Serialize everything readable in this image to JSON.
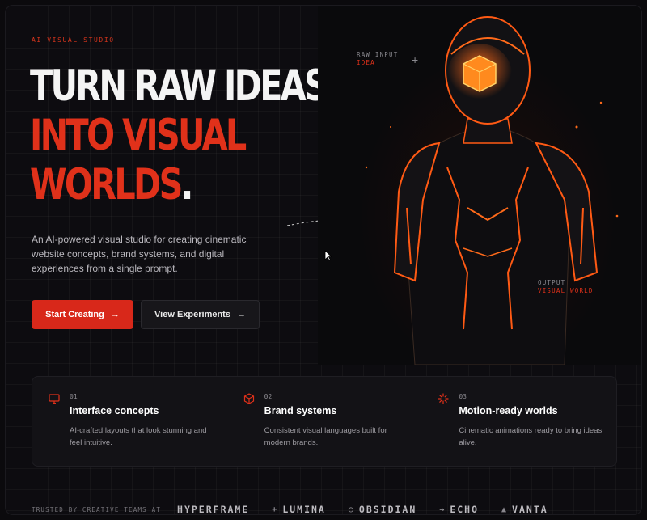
{
  "hero": {
    "eyebrow": "AI VISUAL STUDIO",
    "headline_line1": "TURN RAW IDEAS",
    "headline_line2": "INTO VISUAL",
    "headline_line3": "WORLDS",
    "headline_dot": ".",
    "description": "An AI-powered visual studio for creating cinematic website concepts, brand systems, and digital experiences from a single prompt.",
    "primary_button": "Start Creating",
    "secondary_button": "View Experiments",
    "arrow": "→"
  },
  "image_tags": {
    "input_label": "RAW INPUT",
    "input_value": "IDEA",
    "output_label": "OUTPUT",
    "output_value": "VISUAL WORLD"
  },
  "features": [
    {
      "number": "01",
      "title": "Interface concepts",
      "description": "AI-crafted layouts that look stunning and feel intuitive.",
      "icon": "monitor-icon"
    },
    {
      "number": "02",
      "title": "Brand systems",
      "description": "Consistent visual languages built for modern brands.",
      "icon": "cube-icon"
    },
    {
      "number": "03",
      "title": "Motion-ready worlds",
      "description": "Cinematic animations ready to bring ideas alive.",
      "icon": "sparkle-icon"
    }
  ],
  "trusted": {
    "label": "TRUSTED BY CREATIVE TEAMS AT",
    "brands": [
      {
        "name": "HYPERFRAME",
        "icon": "none"
      },
      {
        "name": "LUMINA",
        "icon": "plus-icon"
      },
      {
        "name": "OBSIDIAN",
        "icon": "circle-icon"
      },
      {
        "name": "ECHO",
        "icon": "arrow-icon"
      },
      {
        "name": "VANTA",
        "icon": "triangle-icon"
      }
    ]
  },
  "colors": {
    "accent": "#e0311a",
    "background": "#0d0c10",
    "text": "#f4f4f4"
  }
}
